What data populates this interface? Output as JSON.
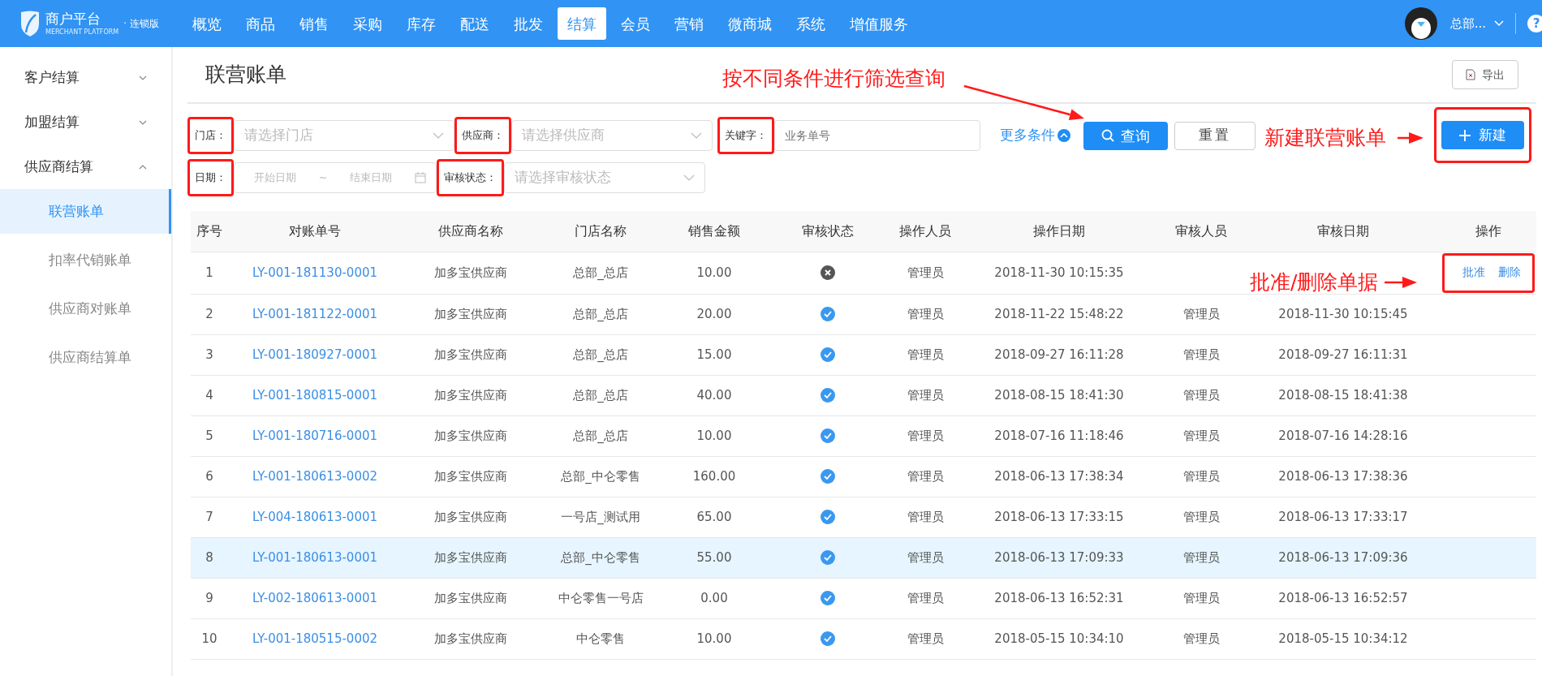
{
  "header": {
    "logo": {
      "title": "商户平台",
      "edition": "· 连锁版",
      "subtitle": "MERCHANT PLATFORM"
    },
    "nav": [
      {
        "label": "概览",
        "selected": false
      },
      {
        "label": "商品",
        "selected": false
      },
      {
        "label": "销售",
        "selected": false
      },
      {
        "label": "采购",
        "selected": false
      },
      {
        "label": "库存",
        "selected": false
      },
      {
        "label": "配送",
        "selected": false
      },
      {
        "label": "批发",
        "selected": false
      },
      {
        "label": "结算",
        "selected": true
      },
      {
        "label": "会员",
        "selected": false
      },
      {
        "label": "营销",
        "selected": false
      },
      {
        "label": "微商城",
        "selected": false
      },
      {
        "label": "系统",
        "selected": false
      },
      {
        "label": "增值服务",
        "selected": false
      }
    ],
    "user": {
      "name": "总部..."
    },
    "help": "?"
  },
  "sidebar": {
    "groups": [
      {
        "label": "客户结算",
        "expanded": false
      },
      {
        "label": "加盟结算",
        "expanded": false
      },
      {
        "label": "供应商结算",
        "expanded": true,
        "children": [
          {
            "label": "联营账单",
            "selected": true
          },
          {
            "label": "扣率代销账单",
            "selected": false
          },
          {
            "label": "供应商对账单",
            "selected": false
          },
          {
            "label": "供应商结算单",
            "selected": false
          }
        ]
      }
    ]
  },
  "page": {
    "title": "联营账单",
    "export_button": "导出"
  },
  "filters": [
    {
      "kind": "select",
      "label": "门店：",
      "placeholder": "请选择门店",
      "highlighted": true
    },
    {
      "kind": "select",
      "label": "供应商：",
      "placeholder": "请选择供应商",
      "highlighted": true
    },
    {
      "kind": "input",
      "label": "关键字：",
      "placeholder": "业务单号",
      "highlighted": true
    },
    {
      "kind": "daterange",
      "label": "日期：",
      "start_placeholder": "开始日期",
      "separator": "~",
      "end_placeholder": "结束日期",
      "highlighted": true
    },
    {
      "kind": "select",
      "label": "审核状态：",
      "placeholder": "请选择审核状态",
      "highlighted": true
    }
  ],
  "more_conditions": "更多条件",
  "buttons": {
    "query": "查询",
    "reset": "重置",
    "create": {
      "label": "新建",
      "highlighted": true
    }
  },
  "table": {
    "columns": [
      "序号",
      "对账单号",
      "供应商名称",
      "门店名称",
      "销售金额",
      "审核状态",
      "操作人员",
      "操作日期",
      "审核人员",
      "审核日期",
      "操作"
    ],
    "rows": [
      {
        "index": "1",
        "number": "LY-001-181130-0001",
        "supplier": "加多宝供应商",
        "store": "总部_总店",
        "amount": "10.00",
        "approved": false,
        "operator": "管理员",
        "op_date": "2018-11-30 10:15:35",
        "actions": [
          "批准",
          "删除"
        ],
        "actions_highlighted": true,
        "selected": false
      },
      {
        "index": "2",
        "number": "LY-001-181122-0001",
        "supplier": "加多宝供应商",
        "store": "总部_总店",
        "amount": "20.00",
        "approved": true,
        "operator": "管理员",
        "op_date": "2018-11-22 15:48:22",
        "reviewer": "管理员",
        "review_date": "2018-11-30 10:15:45",
        "selected": false
      },
      {
        "index": "3",
        "number": "LY-001-180927-0001",
        "supplier": "加多宝供应商",
        "store": "总部_总店",
        "amount": "15.00",
        "approved": true,
        "operator": "管理员",
        "op_date": "2018-09-27 16:11:28",
        "reviewer": "管理员",
        "review_date": "2018-09-27 16:11:31",
        "selected": false
      },
      {
        "index": "4",
        "number": "LY-001-180815-0001",
        "supplier": "加多宝供应商",
        "store": "总部_总店",
        "amount": "40.00",
        "approved": true,
        "operator": "管理员",
        "op_date": "2018-08-15 18:41:30",
        "reviewer": "管理员",
        "review_date": "2018-08-15 18:41:38",
        "selected": false
      },
      {
        "index": "5",
        "number": "LY-001-180716-0001",
        "supplier": "加多宝供应商",
        "store": "总部_总店",
        "amount": "10.00",
        "approved": true,
        "operator": "管理员",
        "op_date": "2018-07-16 11:18:46",
        "reviewer": "管理员",
        "review_date": "2018-07-16 14:28:16",
        "selected": false
      },
      {
        "index": "6",
        "number": "LY-001-180613-0002",
        "supplier": "加多宝供应商",
        "store": "总部_中仑零售",
        "amount": "160.00",
        "approved": true,
        "operator": "管理员",
        "op_date": "2018-06-13 17:38:34",
        "reviewer": "管理员",
        "review_date": "2018-06-13 17:38:36",
        "selected": false
      },
      {
        "index": "7",
        "number": "LY-004-180613-0001",
        "supplier": "加多宝供应商",
        "store": "一号店_测试用",
        "amount": "65.00",
        "approved": true,
        "operator": "管理员",
        "op_date": "2018-06-13 17:33:15",
        "reviewer": "管理员",
        "review_date": "2018-06-13 17:33:17",
        "selected": false
      },
      {
        "index": "8",
        "number": "LY-001-180613-0001",
        "supplier": "加多宝供应商",
        "store": "总部_中仑零售",
        "amount": "55.00",
        "approved": true,
        "operator": "管理员",
        "op_date": "2018-06-13 17:09:33",
        "reviewer": "管理员",
        "review_date": "2018-06-13 17:09:36",
        "selected": true
      },
      {
        "index": "9",
        "number": "LY-002-180613-0001",
        "supplier": "加多宝供应商",
        "store": "中仑零售一号店",
        "amount": "0.00",
        "approved": true,
        "operator": "管理员",
        "op_date": "2018-06-13 16:52:31",
        "reviewer": "管理员",
        "review_date": "2018-06-13 16:52:57",
        "selected": false
      },
      {
        "index": "10",
        "number": "LY-001-180515-0002",
        "supplier": "加多宝供应商",
        "store": "中仑零售",
        "amount": "10.00",
        "approved": true,
        "operator": "管理员",
        "op_date": "2018-05-15 10:34:10",
        "reviewer": "管理员",
        "review_date": "2018-05-15 10:34:12",
        "selected": false
      }
    ]
  },
  "annotations": [
    {
      "text": "按不同条件进行筛选查询"
    },
    {
      "text": "新建联营账单"
    },
    {
      "text": "批准/删除单据"
    }
  ]
}
